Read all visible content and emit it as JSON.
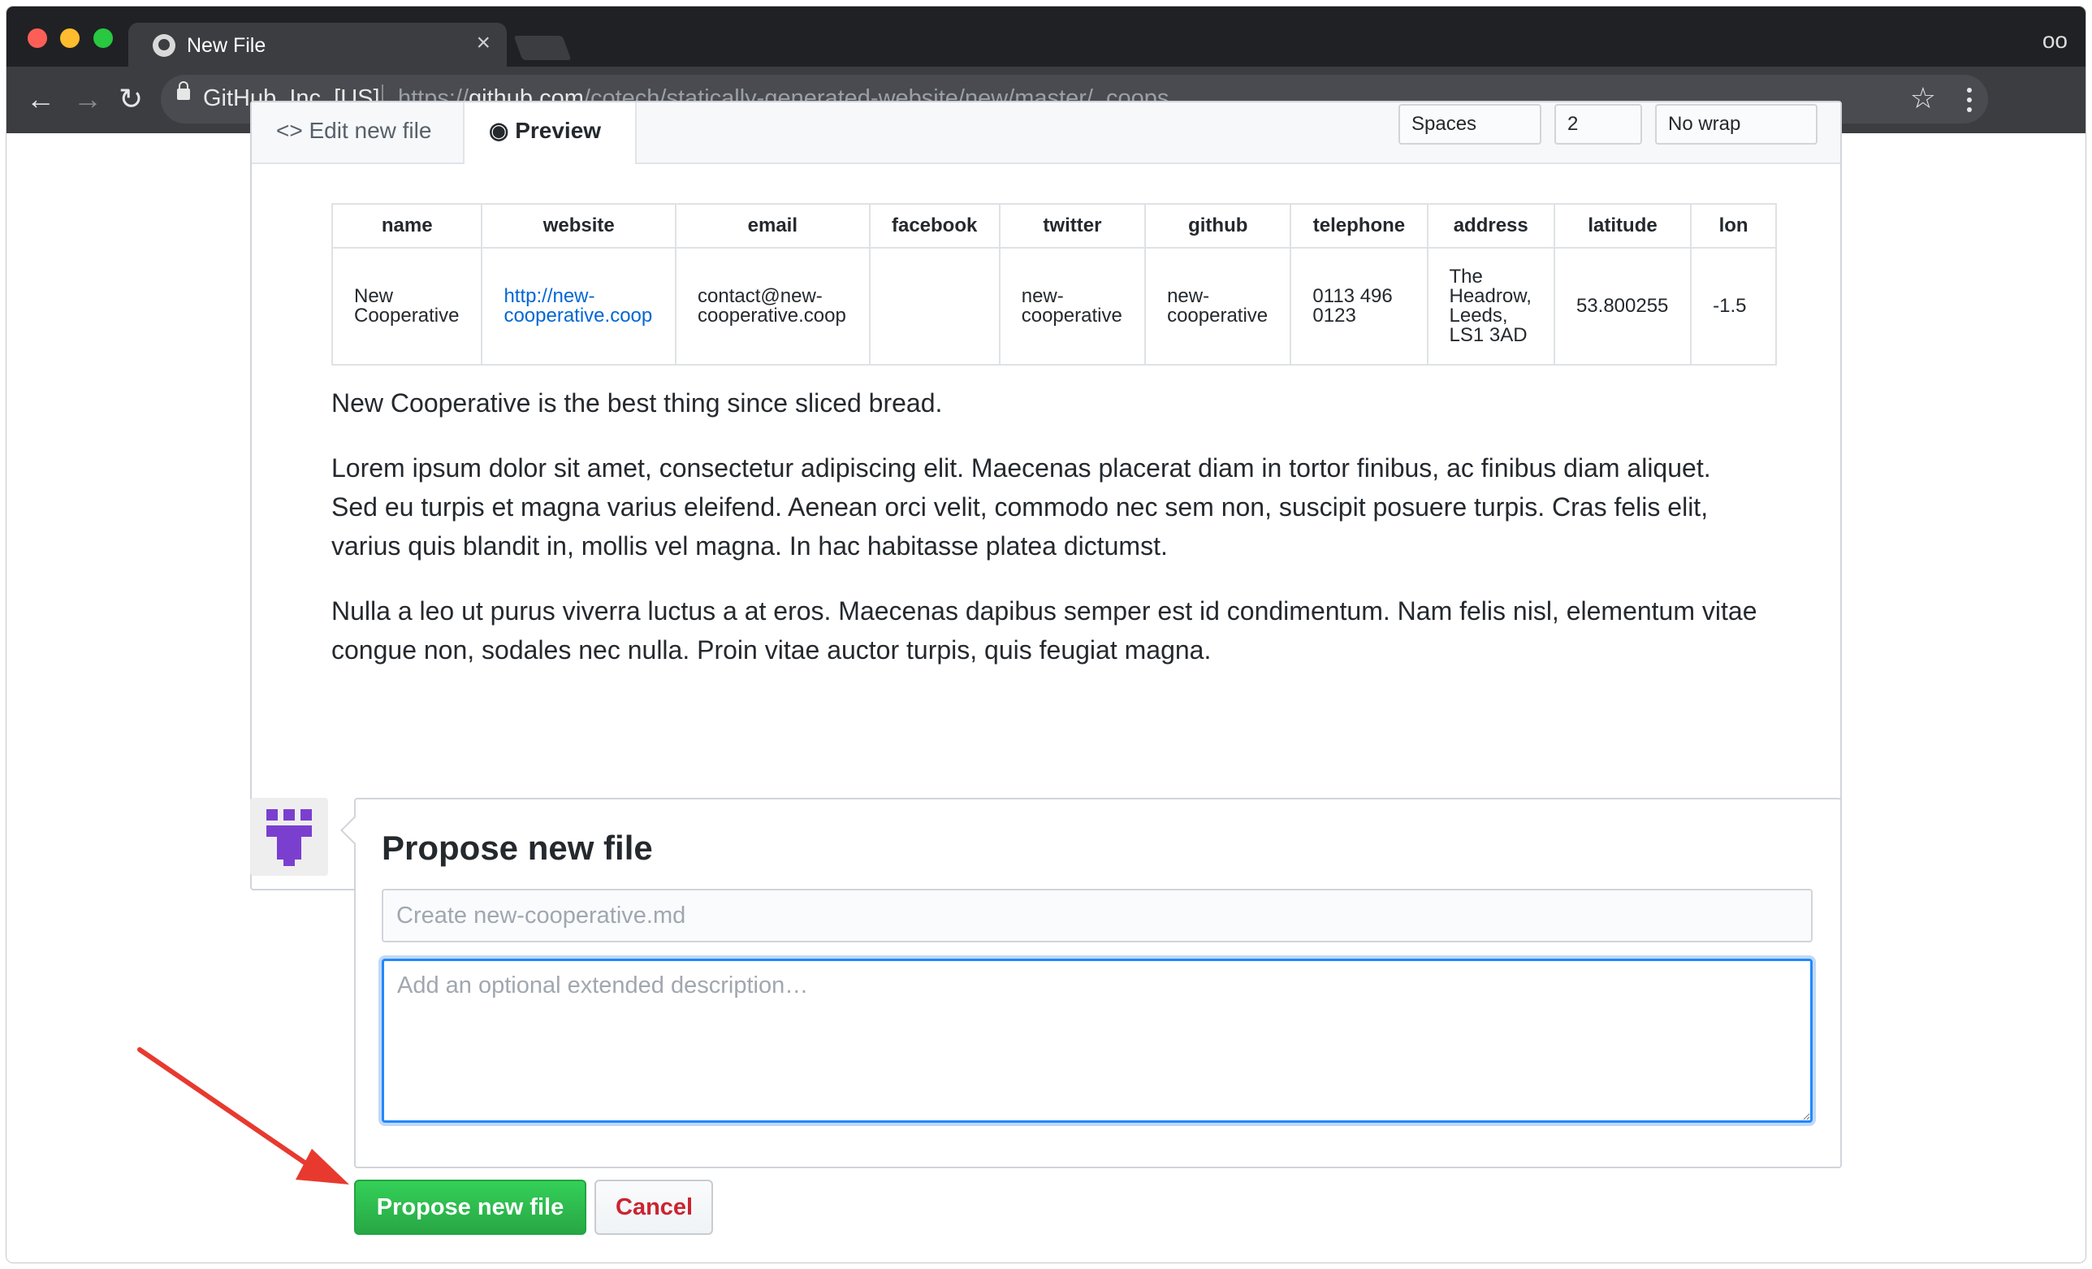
{
  "browser": {
    "tab_title": "New File",
    "tab_close": "×",
    "site_identity": "GitHub, Inc. [US]",
    "url_scheme": "https://",
    "url_host": "github.com",
    "url_path": "/cotech/statically-generated-website/new/master/_coops",
    "back_icon": "←",
    "forward_icon": "→",
    "reload_icon": "↻",
    "star_icon": "☆",
    "incognito_icon": "oo"
  },
  "editor": {
    "tab_edit": "<> Edit new file",
    "tab_preview": "◉ Preview",
    "indent_mode": "Spaces",
    "indent_size": "2",
    "wrap_mode": "No wrap"
  },
  "preview": {
    "table": {
      "headers": [
        "name",
        "website",
        "email",
        "facebook",
        "twitter",
        "github",
        "telephone",
        "address",
        "latitude",
        "lon"
      ],
      "row": {
        "name": "New Cooperative",
        "website": "http://new-cooperative.coop",
        "email": "contact@new-cooperative.coop",
        "facebook": "",
        "twitter": "new-cooperative",
        "github": "new-cooperative",
        "telephone": "0113 496 0123",
        "address": "The Headrow, Leeds, LS1 3AD",
        "latitude": "53.800255",
        "lon": "-1.5"
      }
    },
    "paragraphs": [
      "New Cooperative is the best thing since sliced bread.",
      "Lorem ipsum dolor sit amet, consectetur adipiscing elit. Maecenas placerat diam in tortor finibus, ac finibus diam aliquet. Sed eu turpis et magna varius eleifend. Aenean orci velit, commodo nec sem non, suscipit posuere turpis. Cras felis elit, varius quis blandit in, mollis vel magna. In hac habitasse platea dictumst.",
      "Nulla a leo ut purus viverra luctus a at eros. Maecenas dapibus semper est id condimentum. Nam felis nisl, elementum vitae congue non, sodales nec nulla. Proin vitae auctor turpis, quis feugiat magna."
    ]
  },
  "commit": {
    "title": "Propose new file",
    "summary_placeholder": "Create new-cooperative.md",
    "description_placeholder": "Add an optional extended description…",
    "submit_label": "Propose new file",
    "cancel_label": "Cancel"
  },
  "colors": {
    "primary_button": "#2cbe4e",
    "cancel_text": "#cb2431",
    "focus_ring": "#2188ff",
    "annotation_arrow": "#e8392f",
    "avatar_color": "#7b3fd0"
  }
}
